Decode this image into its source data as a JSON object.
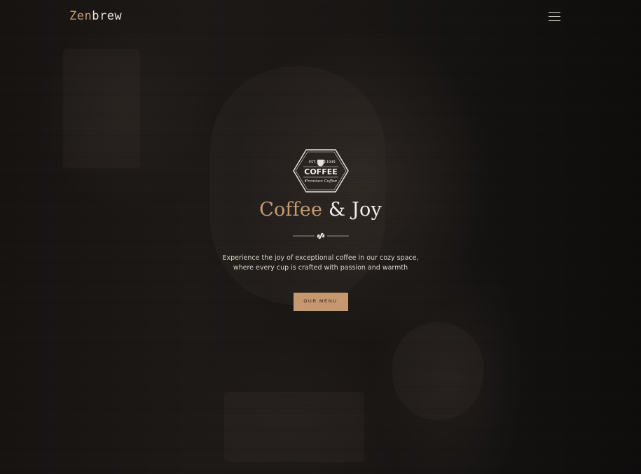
{
  "header": {
    "logo_accent": "Zen",
    "logo_rest": "brew",
    "menu_icon": "hamburger-menu-icon"
  },
  "badge": {
    "est_label": "EST.",
    "year": "1949",
    "title": "COFFEE",
    "subtitle": "Premium Coffee",
    "icon": "coffee-cup-icon"
  },
  "hero": {
    "headline_accent": "Coffee",
    "headline_rest": "& Joy",
    "divider_icon": "coffee-bean-icon",
    "description": "Experience the joy of exceptional coffee in our cozy space, where every cup is crafted with passion and warmth",
    "cta_label": "OUR MENU"
  },
  "colors": {
    "accent": "#c89b72",
    "button": "#c59870",
    "background": "#151211",
    "text": "#f1ece6"
  }
}
